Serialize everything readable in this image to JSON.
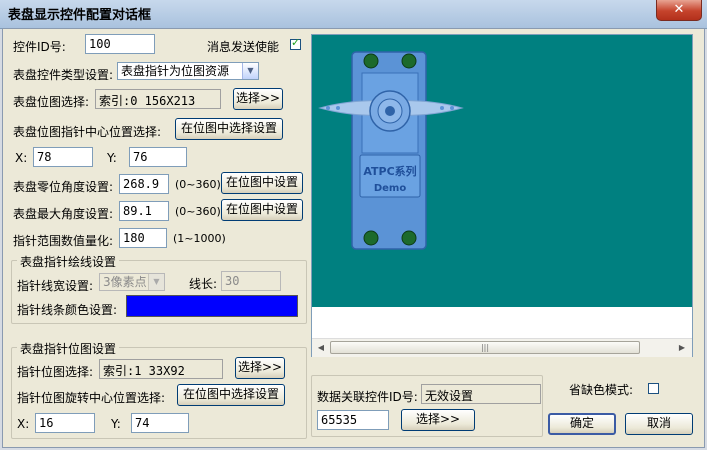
{
  "window": {
    "title": "表盘显示控件配置对话框",
    "close_glyph": "✕"
  },
  "form": {
    "control_id_label": "控件ID号:",
    "control_id_value": "100",
    "msg_send_label": "消息发送使能",
    "msg_send_checked": true,
    "dial_type_label": "表盘控件类型设置:",
    "dial_type_value": "表盘指针为位图资源",
    "dial_bitmap_label": "表盘位图选择:",
    "dial_bitmap_value": "索引:0 156X213",
    "dial_bitmap_btn": "选择>>",
    "pointer_center_label": "表盘位图指针中心位置选择:",
    "pointer_center_btn": "在位图中选择设置",
    "x_label": "X:",
    "x_value": "78",
    "y_label": "Y:",
    "y_value": "76",
    "zero_angle_label": "表盘零位角度设置:",
    "zero_angle_value": "268.9",
    "zero_angle_range": "(0~360)",
    "zero_angle_btn": "在位图中设置",
    "max_angle_label": "表盘最大角度设置:",
    "max_angle_value": "89.1",
    "max_angle_range": "(0~360)",
    "max_angle_btn": "在位图中设置",
    "quant_label": "指针范围数值量化:",
    "quant_value": "180",
    "quant_range": "(1~1000)"
  },
  "line_group": {
    "title": "表盘指针绘线设置",
    "width_label": "指针线宽设置:",
    "width_value": "3像素点",
    "length_label": "线长:",
    "length_value": "30",
    "color_label": "指针线条颜色设置:",
    "color_value": "#0000ff"
  },
  "bitmap_group": {
    "title": "表盘指针位图设置",
    "bitmap_label": "指针位图选择:",
    "bitmap_value": "索引:1 33X92",
    "bitmap_btn": "选择>>",
    "rot_center_label": "指针位图旋转中心位置选择:",
    "rot_center_btn": "在位图中选择设置",
    "x_label": "X:",
    "x_value": "16",
    "y_label": "Y:",
    "y_value": "74"
  },
  "link": {
    "label": "数据关联控件ID号:",
    "status": "无效设置",
    "value": "65535",
    "btn": "选择>>"
  },
  "default_color": {
    "label": "省缺色模式:",
    "checked": false
  },
  "actions": {
    "ok": "确定",
    "cancel": "取消"
  },
  "preview": {
    "bg_color": "#008080",
    "logo_text": "ATPC系列",
    "logo_sub": "Demo",
    "scroll_left": "◀",
    "scroll_right": "▶",
    "scroll_grip": "|||"
  }
}
